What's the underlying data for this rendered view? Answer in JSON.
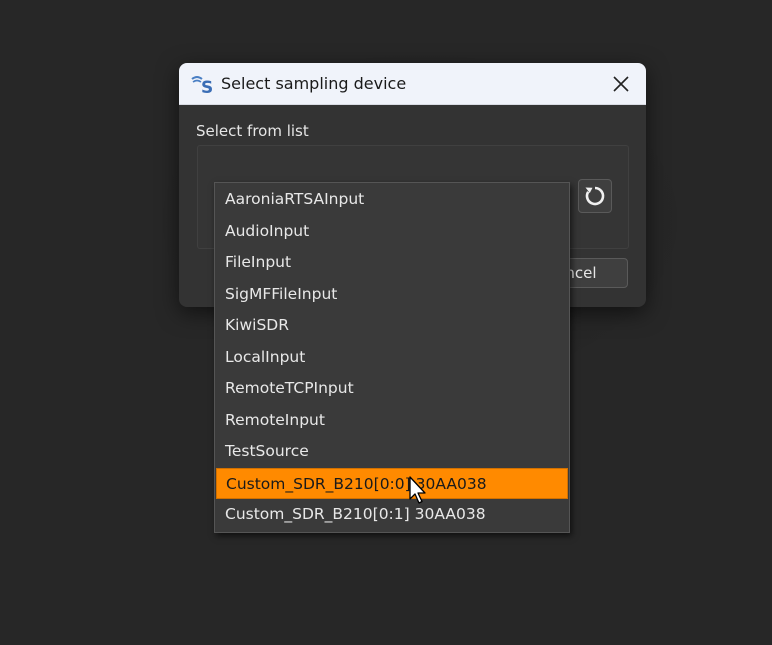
{
  "dialog": {
    "title": "Select sampling device",
    "section_label": "Select from list",
    "cancel_label": "ncel"
  },
  "dropdown": {
    "items": [
      "AaroniaRTSAInput",
      "AudioInput",
      "FileInput",
      "SigMFFileInput",
      "KiwiSDR",
      "LocalInput",
      "RemoteTCPInput",
      "RemoteInput",
      "TestSource",
      "Custom_SDR_B210[0:0] 30AA038",
      "Custom_SDR_B210[0:1] 30AA038"
    ],
    "selected_index": 9
  },
  "icons": {
    "app": "sdrangel-logo-icon",
    "close": "close-icon",
    "refresh": "refresh-icon",
    "cursor": "mouse-pointer-icon"
  },
  "colors": {
    "highlight": "#ff8a00",
    "background": "#272727",
    "dialog": "#333333",
    "titlebar": "#f0f3fa"
  }
}
